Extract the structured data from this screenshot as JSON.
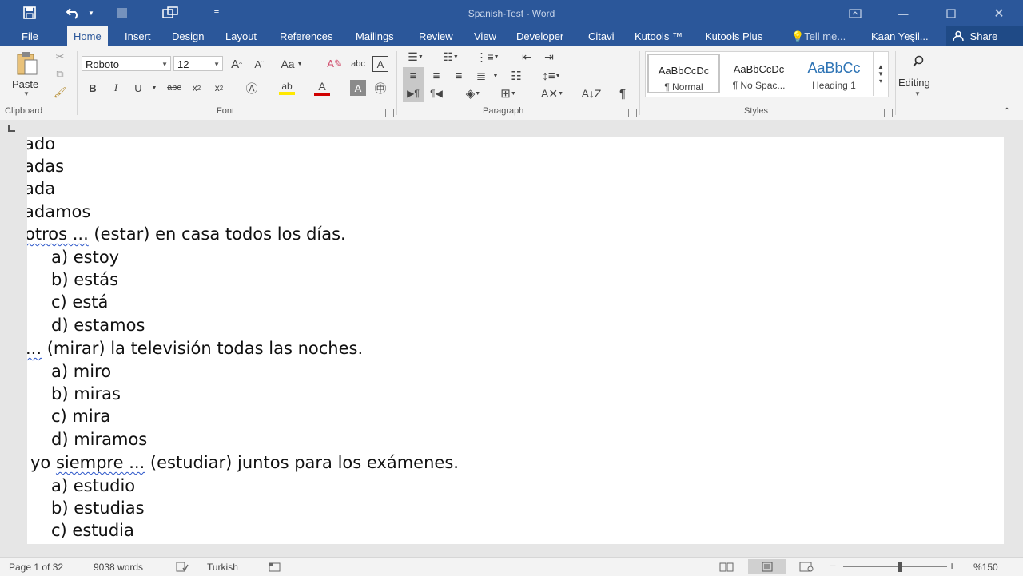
{
  "titlebar": {
    "document_title": "Spanish-Test - Word",
    "save_icon": "save-icon",
    "undo_icon": "undo-icon",
    "customize_icon": "customize-icon",
    "window_controls": [
      "restore-ribbon-icon",
      "minimize-icon",
      "maximize-icon",
      "close-icon"
    ]
  },
  "tabs": [
    {
      "label": "File"
    },
    {
      "label": "Home",
      "active": true
    },
    {
      "label": "Insert"
    },
    {
      "label": "Design"
    },
    {
      "label": "Layout"
    },
    {
      "label": "References"
    },
    {
      "label": "Mailings"
    },
    {
      "label": "Review"
    },
    {
      "label": "View"
    },
    {
      "label": "Developer"
    },
    {
      "label": "Citavi"
    },
    {
      "label": "Kutools ™"
    },
    {
      "label": "Kutools Plus"
    },
    {
      "label": "Tell me..."
    },
    {
      "label": "Kaan Yeşil..."
    }
  ],
  "share_label": "Share",
  "ribbon": {
    "clipboard": {
      "label": "Clipboard",
      "paste_label": "Paste"
    },
    "font": {
      "label": "Font",
      "font_name": "Roboto",
      "font_size": "12"
    },
    "paragraph": {
      "label": "Paragraph"
    },
    "styles": {
      "label": "Styles",
      "items": [
        {
          "sample": "AaBbCcDc",
          "name": "¶ Normal"
        },
        {
          "sample": "AaBbCcDc",
          "name": "¶ No Spac..."
        },
        {
          "sample": "AaBbCc",
          "name": "Heading 1"
        }
      ]
    },
    "editing": {
      "label": "Editing"
    }
  },
  "document": {
    "lines": [
      {
        "text": "ado"
      },
      {
        "text": "adas"
      },
      {
        "text": "ada"
      },
      {
        "text": "adamos"
      },
      {
        "text_a": "otros ...",
        "text_b": " (estar) en casa todos los días."
      },
      {
        "text": "a) estoy"
      },
      {
        "text": "b) estás"
      },
      {
        "text": "c) está"
      },
      {
        "text": "d) estamos"
      },
      {
        "text_a": "...",
        "text_b": " (mirar) la televisión todas las noches."
      },
      {
        "text": "a) miro"
      },
      {
        "text": "b) miras"
      },
      {
        "text": "c) mira"
      },
      {
        "text": "d) miramos"
      },
      {
        "text_0": "yo ",
        "text_a": "siempre ...",
        "text_b": " (estudiar) juntos para los exámenes."
      },
      {
        "text": "a) estudio"
      },
      {
        "text": "b) estudias"
      },
      {
        "text": "c) estudia"
      }
    ]
  },
  "status": {
    "page": "Page 1 of 32",
    "words": "9038 words",
    "language": "Turkish",
    "zoom": "%150",
    "zoom_minus": "−",
    "zoom_plus": "+"
  },
  "colors": {
    "titlebar": "#2b579a",
    "ribbon": "#f3f3f3",
    "font_color_bar": "#d00000",
    "highlight_bar": "#ffe800"
  }
}
